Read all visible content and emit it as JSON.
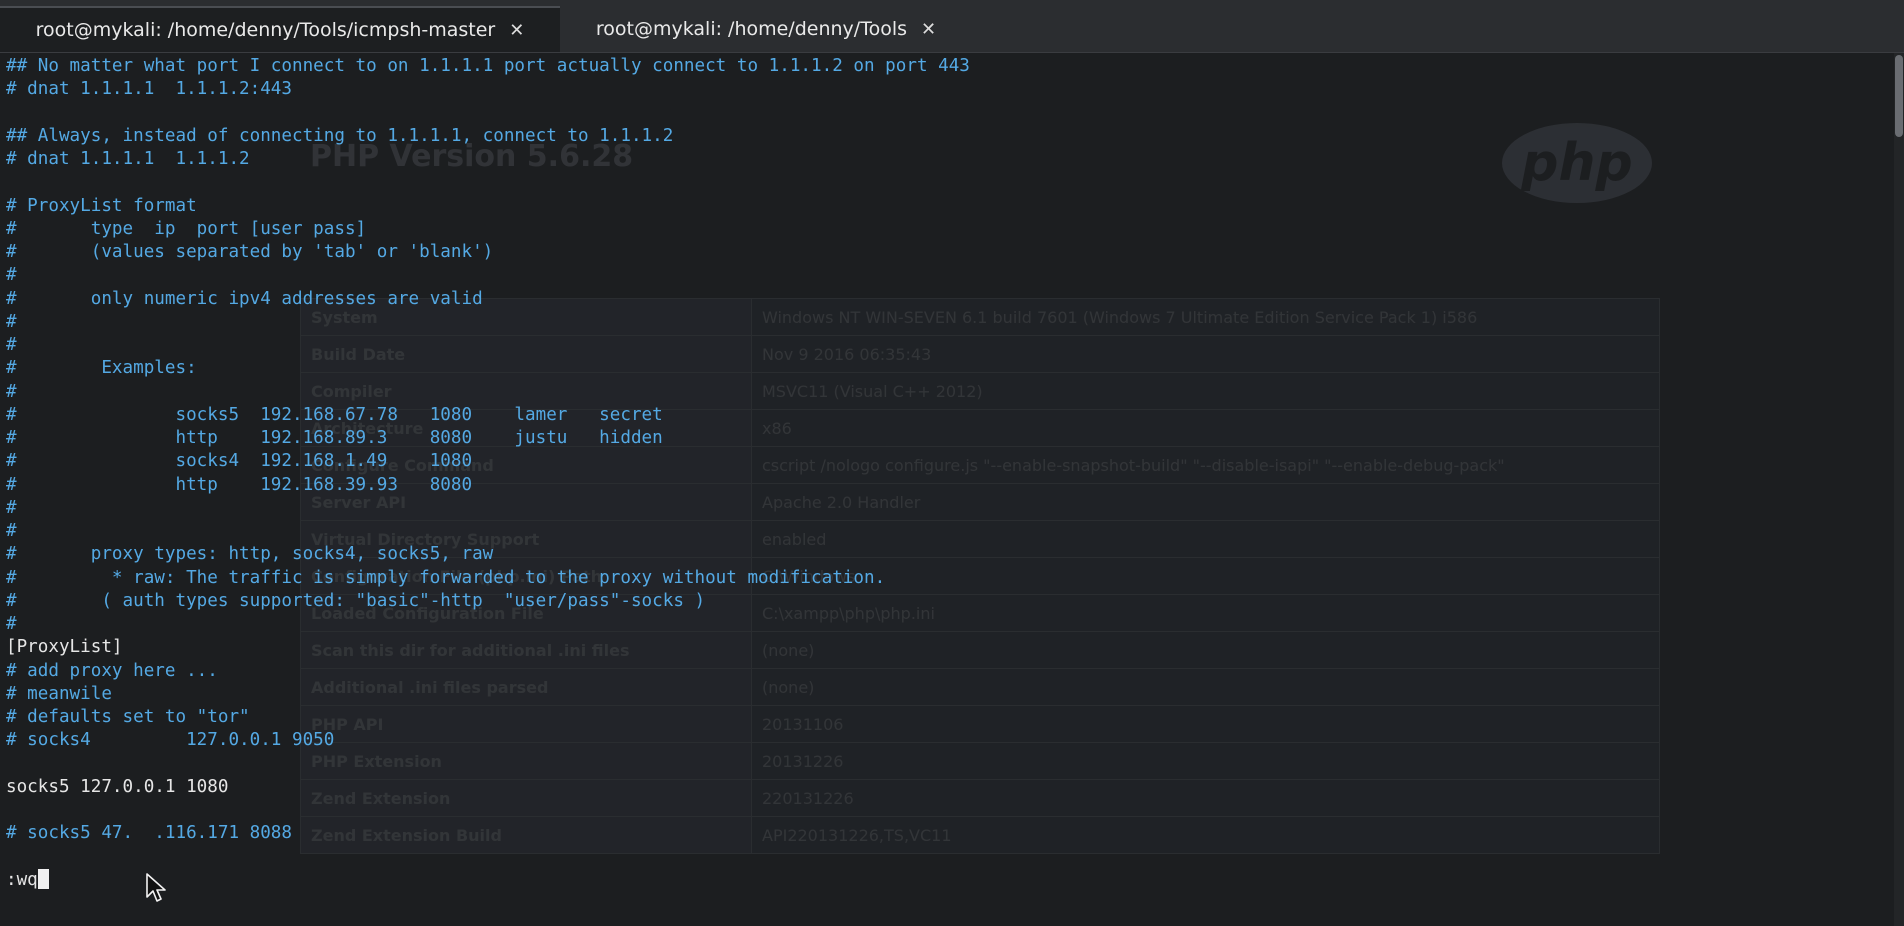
{
  "tabs": [
    {
      "title": "root@mykali: /home/denny/Tools/icmpsh-master",
      "close": "✕"
    },
    {
      "title": "root@mykali: /home/denny/Tools",
      "close": "✕"
    }
  ],
  "terminal": {
    "lines": [
      {
        "text": "## No matter what port I connect to on 1.1.1.1 port actually connect to 1.1.1.2 on port 443",
        "style": "comment"
      },
      {
        "text": "# dnat 1.1.1.1  1.1.1.2:443",
        "style": "comment"
      },
      {
        "text": "",
        "style": "comment"
      },
      {
        "text": "## Always, instead of connecting to 1.1.1.1, connect to 1.1.1.2",
        "style": "comment"
      },
      {
        "text": "# dnat 1.1.1.1  1.1.1.2",
        "style": "comment"
      },
      {
        "text": "",
        "style": "comment"
      },
      {
        "text": "# ProxyList format",
        "style": "comment"
      },
      {
        "text": "#       type  ip  port [user pass]",
        "style": "comment"
      },
      {
        "text": "#       (values separated by 'tab' or 'blank')",
        "style": "comment"
      },
      {
        "text": "#",
        "style": "comment"
      },
      {
        "text": "#       only numeric ipv4 addresses are valid",
        "style": "comment"
      },
      {
        "text": "#",
        "style": "comment"
      },
      {
        "text": "#",
        "style": "comment"
      },
      {
        "text": "#        Examples:",
        "style": "comment"
      },
      {
        "text": "#",
        "style": "comment"
      },
      {
        "text": "#               socks5  192.168.67.78   1080    lamer   secret",
        "style": "comment"
      },
      {
        "text": "#               http    192.168.89.3    8080    justu   hidden",
        "style": "comment"
      },
      {
        "text": "#               socks4  192.168.1.49    1080",
        "style": "comment"
      },
      {
        "text": "#               http    192.168.39.93   8080",
        "style": "comment"
      },
      {
        "text": "#",
        "style": "comment"
      },
      {
        "text": "#",
        "style": "comment"
      },
      {
        "text": "#       proxy types: http, socks4, socks5, raw",
        "style": "comment"
      },
      {
        "text": "#         * raw: The traffic is simply forwarded to the proxy without modification.",
        "style": "comment"
      },
      {
        "text": "#        ( auth types supported: \"basic\"-http  \"user/pass\"-socks )",
        "style": "comment"
      },
      {
        "text": "#",
        "style": "comment"
      },
      {
        "text": "[ProxyList]",
        "style": "plain"
      },
      {
        "text": "# add proxy here ...",
        "style": "comment"
      },
      {
        "text": "# meanwile",
        "style": "comment"
      },
      {
        "text": "# defaults set to \"tor\"",
        "style": "comment"
      },
      {
        "text": "# socks4         127.0.0.1 9050",
        "style": "comment"
      },
      {
        "text": "",
        "style": "plain"
      },
      {
        "text": "socks5 127.0.0.1 1080",
        "style": "plain"
      },
      {
        "text": "",
        "style": "plain"
      },
      {
        "text": "# socks5 47.  .116.171 8088",
        "style": "comment"
      },
      {
        "text": "",
        "style": "plain"
      },
      {
        "text": ":wq",
        "style": "plain",
        "cursor": true
      }
    ]
  },
  "background_window": {
    "title": "PHP Version 5.6.28",
    "logo": "php",
    "rows": [
      {
        "k": "System",
        "v": "Windows NT WIN-SEVEN 6.1 build 7601 (Windows 7 Ultimate Edition Service Pack 1) i586"
      },
      {
        "k": "Build Date",
        "v": "Nov 9 2016 06:35:43"
      },
      {
        "k": "Compiler",
        "v": "MSVC11 (Visual C++ 2012)"
      },
      {
        "k": "Architecture",
        "v": "x86"
      },
      {
        "k": "Configure Command",
        "v": "cscript /nologo configure.js \"--enable-snapshot-build\" \"--disable-isapi\" \"--enable-debug-pack\""
      },
      {
        "k": "Server API",
        "v": "Apache 2.0 Handler"
      },
      {
        "k": "Virtual Directory Support",
        "v": "enabled"
      },
      {
        "k": "Configuration File (php.ini) Path",
        "v": "C:\\Windows"
      },
      {
        "k": "Loaded Configuration File",
        "v": "C:\\xampp\\php\\php.ini"
      },
      {
        "k": "Scan this dir for additional .ini files",
        "v": "(none)"
      },
      {
        "k": "Additional .ini files parsed",
        "v": "(none)"
      },
      {
        "k": "PHP API",
        "v": "20131106"
      },
      {
        "k": "PHP Extension",
        "v": "20131226"
      },
      {
        "k": "Zend Extension",
        "v": "220131226"
      },
      {
        "k": "Zend Extension Build",
        "v": "API220131226,TS,VC11"
      }
    ]
  },
  "colors": {
    "comment": "#54a9e4",
    "plain": "#e6e6e6",
    "background": "#1c1e20",
    "tab_bar": "#2b2d30"
  },
  "icons": {
    "tab_close": "close-icon",
    "pointer": "mouse-pointer-icon"
  }
}
